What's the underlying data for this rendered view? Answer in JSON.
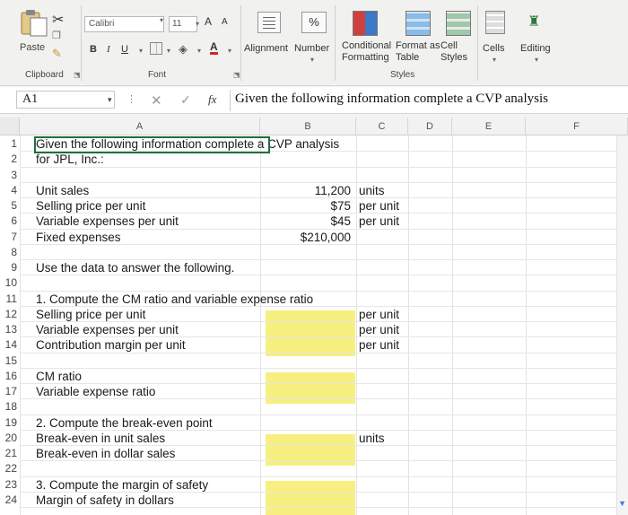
{
  "ribbon": {
    "clipboard": {
      "paste_label": "Paste",
      "group_label": "Clipboard"
    },
    "font": {
      "font_name": "Calibri",
      "font_size": "11",
      "grow_label": "A",
      "shrink_label": "A",
      "bold_label": "B",
      "italic_label": "I",
      "underline_label": "U",
      "font_color_label": "A",
      "group_label": "Font"
    },
    "alignment_label": "Alignment",
    "number": {
      "label": "Number",
      "icon_text": "%"
    },
    "styles": {
      "conditional_formatting_label": "Conditional Formatting",
      "format_as_table_label": "Format as Table",
      "cell_styles_label": "Cell Styles",
      "group_label": "Styles"
    },
    "cells_label": "Cells",
    "editing_label": "Editing"
  },
  "formula_bar": {
    "name_box": "A1",
    "fx_label": "fx",
    "formula": "Given the following information complete a CVP analysis"
  },
  "columns": [
    "A",
    "B",
    "C",
    "D",
    "E",
    "F"
  ],
  "rows": [
    {
      "n": "1",
      "a": "Given the following information complete a CVP analysis",
      "b": "",
      "c": ""
    },
    {
      "n": "2",
      "a": "for JPL, Inc.:",
      "b": "",
      "c": ""
    },
    {
      "n": "3",
      "a": "",
      "b": "",
      "c": ""
    },
    {
      "n": "4",
      "a": "Unit sales",
      "b": "11,200",
      "c": "units"
    },
    {
      "n": "5",
      "a": "Selling price per unit",
      "b": "$75",
      "c": "per unit"
    },
    {
      "n": "6",
      "a": "Variable expenses per unit",
      "b": "$45",
      "c": "per unit"
    },
    {
      "n": "7",
      "a": "Fixed expenses",
      "b": "$210,000",
      "c": ""
    },
    {
      "n": "8",
      "a": "",
      "b": "",
      "c": ""
    },
    {
      "n": "9",
      "a": "Use the data to answer the following.",
      "b": "",
      "c": ""
    },
    {
      "n": "10",
      "a": "",
      "b": "",
      "c": ""
    },
    {
      "n": "11",
      "a": "1. Compute the CM ratio and variable expense ratio",
      "b": "",
      "c": ""
    },
    {
      "n": "12",
      "a": "Selling price per unit",
      "b": "",
      "c": "per unit"
    },
    {
      "n": "13",
      "a": "Variable expenses per unit",
      "b": "",
      "c": "per unit"
    },
    {
      "n": "14",
      "a": "Contribution margin per unit",
      "b": "",
      "c": "per unit"
    },
    {
      "n": "15",
      "a": "",
      "b": "",
      "c": ""
    },
    {
      "n": "16",
      "a": "CM ratio",
      "b": "",
      "c": ""
    },
    {
      "n": "17",
      "a": "Variable expense ratio",
      "b": "",
      "c": ""
    },
    {
      "n": "18",
      "a": "",
      "b": "",
      "c": ""
    },
    {
      "n": "19",
      "a": "2. Compute the break-even point",
      "b": "",
      "c": ""
    },
    {
      "n": "20",
      "a": "Break-even in unit sales",
      "b": "",
      "c": "units"
    },
    {
      "n": "21",
      "a": "Break-even in dollar sales",
      "b": "",
      "c": ""
    },
    {
      "n": "22",
      "a": "",
      "b": "",
      "c": ""
    },
    {
      "n": "23",
      "a": "3. Compute the margin of safety",
      "b": "",
      "c": ""
    },
    {
      "n": "24",
      "a": "Margin of safety in dollars",
      "b": "",
      "c": ""
    }
  ],
  "answer_cell_color": "#f7ef80",
  "active_border_color": "#1f6f3e"
}
